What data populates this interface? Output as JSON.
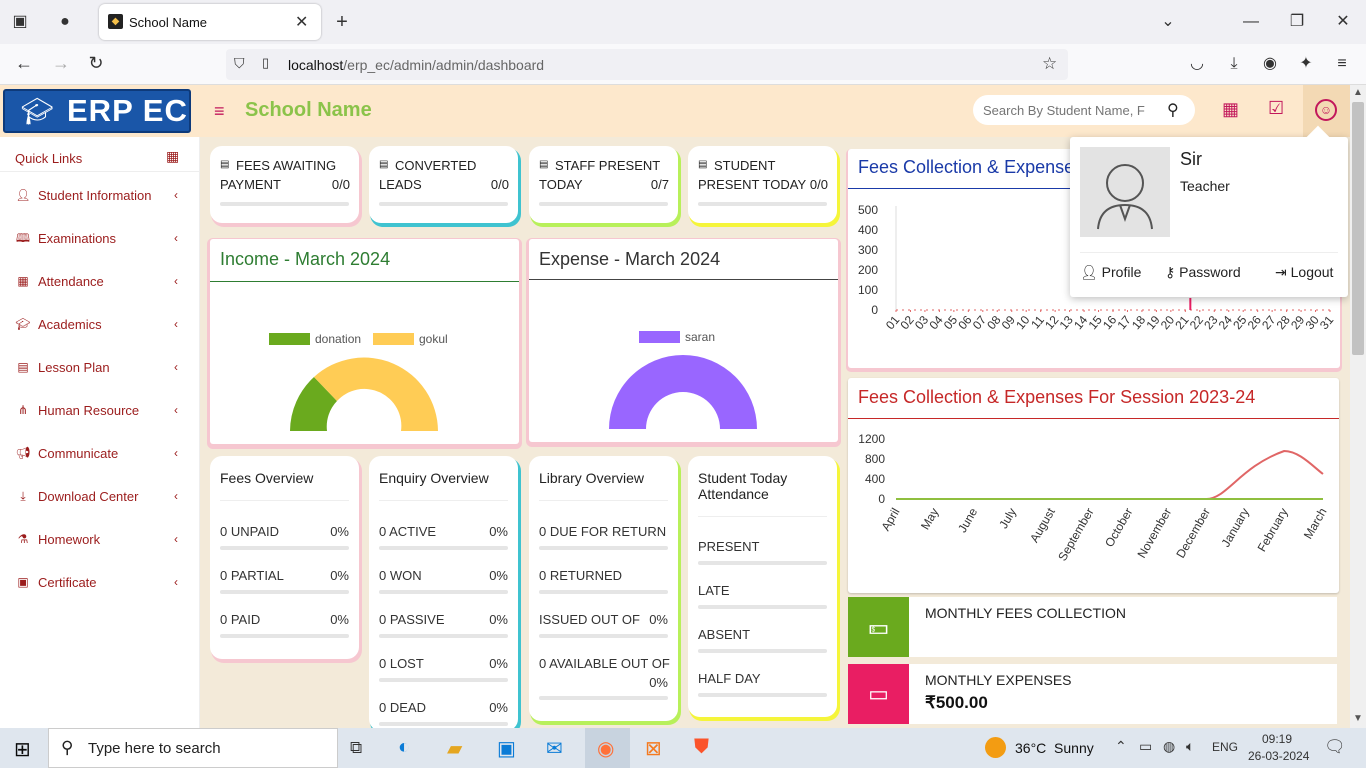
{
  "browser": {
    "tab_title": "School Name",
    "url_host": "localhost",
    "url_path": "/erp_ec/admin/admin/dashboard"
  },
  "header": {
    "logo_text": "ERP EC",
    "school_name": "School Name",
    "search_placeholder": "Search By Student Name, F"
  },
  "sidebar": {
    "quick_links": "Quick Links",
    "items": [
      {
        "label": "Student Information",
        "icon": "user-plus-icon"
      },
      {
        "label": "Examinations",
        "icon": "book-icon"
      },
      {
        "label": "Attendance",
        "icon": "calendar-check-icon"
      },
      {
        "label": "Academics",
        "icon": "graduation-cap-icon"
      },
      {
        "label": "Lesson Plan",
        "icon": "list-icon"
      },
      {
        "label": "Human Resource",
        "icon": "sitemap-icon"
      },
      {
        "label": "Communicate",
        "icon": "bullhorn-icon"
      },
      {
        "label": "Download Center",
        "icon": "download-icon"
      },
      {
        "label": "Homework",
        "icon": "flask-icon"
      },
      {
        "label": "Certificate",
        "icon": "certificate-icon"
      }
    ]
  },
  "stats": [
    {
      "line1": "FEES AWAITING",
      "line2": "PAYMENT",
      "value": "0/0",
      "color": "#f6c7d0",
      "icon": "money-icon"
    },
    {
      "line1": "CONVERTED",
      "line2": "LEADS",
      "value": "0/0",
      "color": "#3fc3d0",
      "icon": "ticket-icon"
    },
    {
      "line1": "STAFF PRESENT",
      "line2": "TODAY",
      "value": "0/7",
      "color": "#b8f05a",
      "icon": "calendar-icon"
    },
    {
      "line1": "STUDENT",
      "line2": "PRESENT TODAY",
      "value": "0/0",
      "color": "#f5f53a",
      "icon": "calendar-icon"
    }
  ],
  "income": {
    "title": "Income - March 2024",
    "legend": [
      {
        "name": "donation",
        "color": "#6aaa1e"
      },
      {
        "name": "gokul",
        "color": "#ffcc55"
      }
    ]
  },
  "expense": {
    "title": "Expense - March 2024",
    "legend": [
      {
        "name": "saran",
        "color": "#9966ff"
      }
    ]
  },
  "overviews": {
    "fees": {
      "title": "Fees Overview",
      "rows": [
        {
          "label": "0 UNPAID",
          "pct": "0%"
        },
        {
          "label": "0 PARTIAL",
          "pct": "0%"
        },
        {
          "label": "0 PAID",
          "pct": "0%"
        }
      ]
    },
    "enquiry": {
      "title": "Enquiry Overview",
      "rows": [
        {
          "label": "0 ACTIVE",
          "pct": "0%"
        },
        {
          "label": "0 WON",
          "pct": "0%"
        },
        {
          "label": "0 PASSIVE",
          "pct": "0%"
        },
        {
          "label": "0 LOST",
          "pct": "0%"
        },
        {
          "label": "0 DEAD",
          "pct": "0%"
        }
      ]
    },
    "library": {
      "title": "Library Overview",
      "rows": [
        {
          "label": "0 DUE FOR RETURN",
          "pct": ""
        },
        {
          "label": "0 RETURNED",
          "pct": ""
        },
        {
          "label": "ISSUED OUT OF",
          "pct": "0%"
        },
        {
          "label": "0 AVAILABLE OUT OF",
          "pct": "0%"
        }
      ]
    },
    "attendance": {
      "title_line1": "Student Today",
      "title_line2": "Attendance",
      "rows": [
        {
          "label": "PRESENT"
        },
        {
          "label": "LATE"
        },
        {
          "label": "ABSENT"
        },
        {
          "label": "HALF DAY"
        }
      ]
    }
  },
  "chart_data": [
    {
      "type": "line",
      "title": "Fees Collection & Expense",
      "x": [
        "01",
        "02",
        "03",
        "04",
        "05",
        "06",
        "07",
        "08",
        "09",
        "10",
        "11",
        "12",
        "13",
        "14",
        "15",
        "16",
        "17",
        "18",
        "19",
        "20",
        "21",
        "22",
        "23",
        "24",
        "25",
        "26",
        "27",
        "28",
        "29",
        "30",
        "31"
      ],
      "yticks": [
        0,
        100,
        200,
        300,
        400,
        500
      ],
      "ylim": [
        0,
        500
      ]
    },
    {
      "type": "line",
      "title": "Fees Collection & Expenses For Session 2023-24",
      "x": [
        "April",
        "May",
        "June",
        "July",
        "August",
        "September",
        "October",
        "November",
        "December",
        "January",
        "February",
        "March"
      ],
      "yticks": [
        0,
        400,
        800,
        1200
      ],
      "ylim": [
        0,
        1200
      ],
      "series": [
        {
          "color": "#e06666",
          "values": [
            0,
            0,
            0,
            0,
            0,
            0,
            0,
            0,
            0,
            500,
            1000,
            500
          ]
        },
        {
          "color": "#8fbf3f",
          "values": [
            0,
            0,
            0,
            0,
            0,
            0,
            0,
            0,
            0,
            0,
            0,
            0
          ]
        }
      ]
    }
  ],
  "monthly": {
    "fees_label": "MONTHLY FEES COLLECTION",
    "exp_label": "MONTHLY EXPENSES",
    "exp_value": "₹500.00"
  },
  "profile": {
    "name": "Sir",
    "role": "Teacher",
    "profile_label": "Profile",
    "password_label": "Password",
    "logout_label": "Logout"
  },
  "taskbar": {
    "search_placeholder": "Type here to search",
    "weather": "36°C  Sunny",
    "lang": "ENG",
    "time": "09:19",
    "date": "26-03-2024"
  }
}
